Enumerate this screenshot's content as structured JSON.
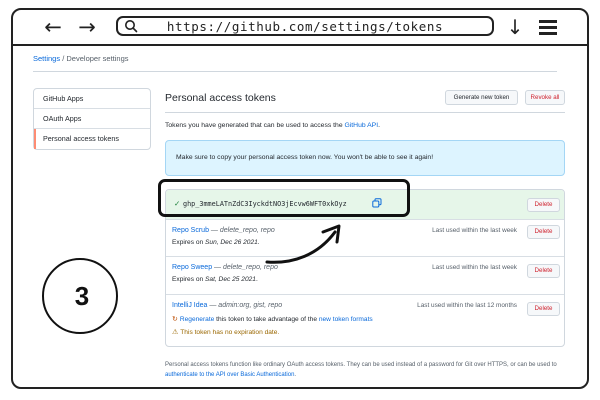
{
  "browser": {
    "back_glyph": "←",
    "forward_glyph": "→",
    "url": "https://github.com/settings/tokens",
    "download_glyph": "↓"
  },
  "breadcrumb": {
    "settings": "Settings",
    "separator": "/",
    "current": "Developer settings"
  },
  "sidebar": {
    "items": [
      {
        "label": "GitHub Apps"
      },
      {
        "label": "OAuth Apps"
      },
      {
        "label": "Personal access tokens"
      }
    ]
  },
  "main": {
    "title": "Personal access tokens",
    "generate_label": "Generate new token",
    "revoke_label": "Revoke all",
    "intro_prefix": "Tokens you have generated that can be used to access the ",
    "intro_link": "GitHub API",
    "intro_suffix": ".",
    "flash": "Make sure to copy your personal access token now. You won't be able to see it again!"
  },
  "new_token": {
    "check_glyph": "✓",
    "value": "ghp_3mmeLATnZdC3IyckdtNO3jEcvw6WFT0xkOyz",
    "delete_label": "Delete"
  },
  "tokens": [
    {
      "name": "Repo Scrub",
      "scopes": " — delete_repo, repo",
      "expires_prefix": "Expires on ",
      "expires_date": "Sun, Dec 26 2021",
      "expires_suffix": ".",
      "last_used": "Last used within the last week",
      "delete_label": "Delete"
    },
    {
      "name": "Repo Sweep",
      "scopes": " — delete_repo, repo",
      "expires_prefix": "Expires on ",
      "expires_date": "Sat, Dec 25 2021",
      "expires_suffix": ".",
      "last_used": "Last used within the last week",
      "delete_label": "Delete"
    },
    {
      "name": "IntelliJ Idea",
      "scopes": " — admin:org, gist, repo",
      "last_used": "Last used within the last 12 months",
      "delete_label": "Delete",
      "regen_glyph": "↻",
      "regen_link": "Regenerate",
      "regen_mid": " this token to take advantage of the ",
      "regen_link2": "new token formats",
      "regen_suffix": "",
      "warn_glyph": "⚠",
      "warn_text": "This token has no expiration date."
    }
  ],
  "footnote": {
    "text": "Personal access tokens function like ordinary OAuth access tokens. They can be used instead of a password for Git over HTTPS, or can be used to ",
    "link": "authenticate to the API over Basic Authentication",
    "suffix": "."
  },
  "step": {
    "number": "3"
  }
}
